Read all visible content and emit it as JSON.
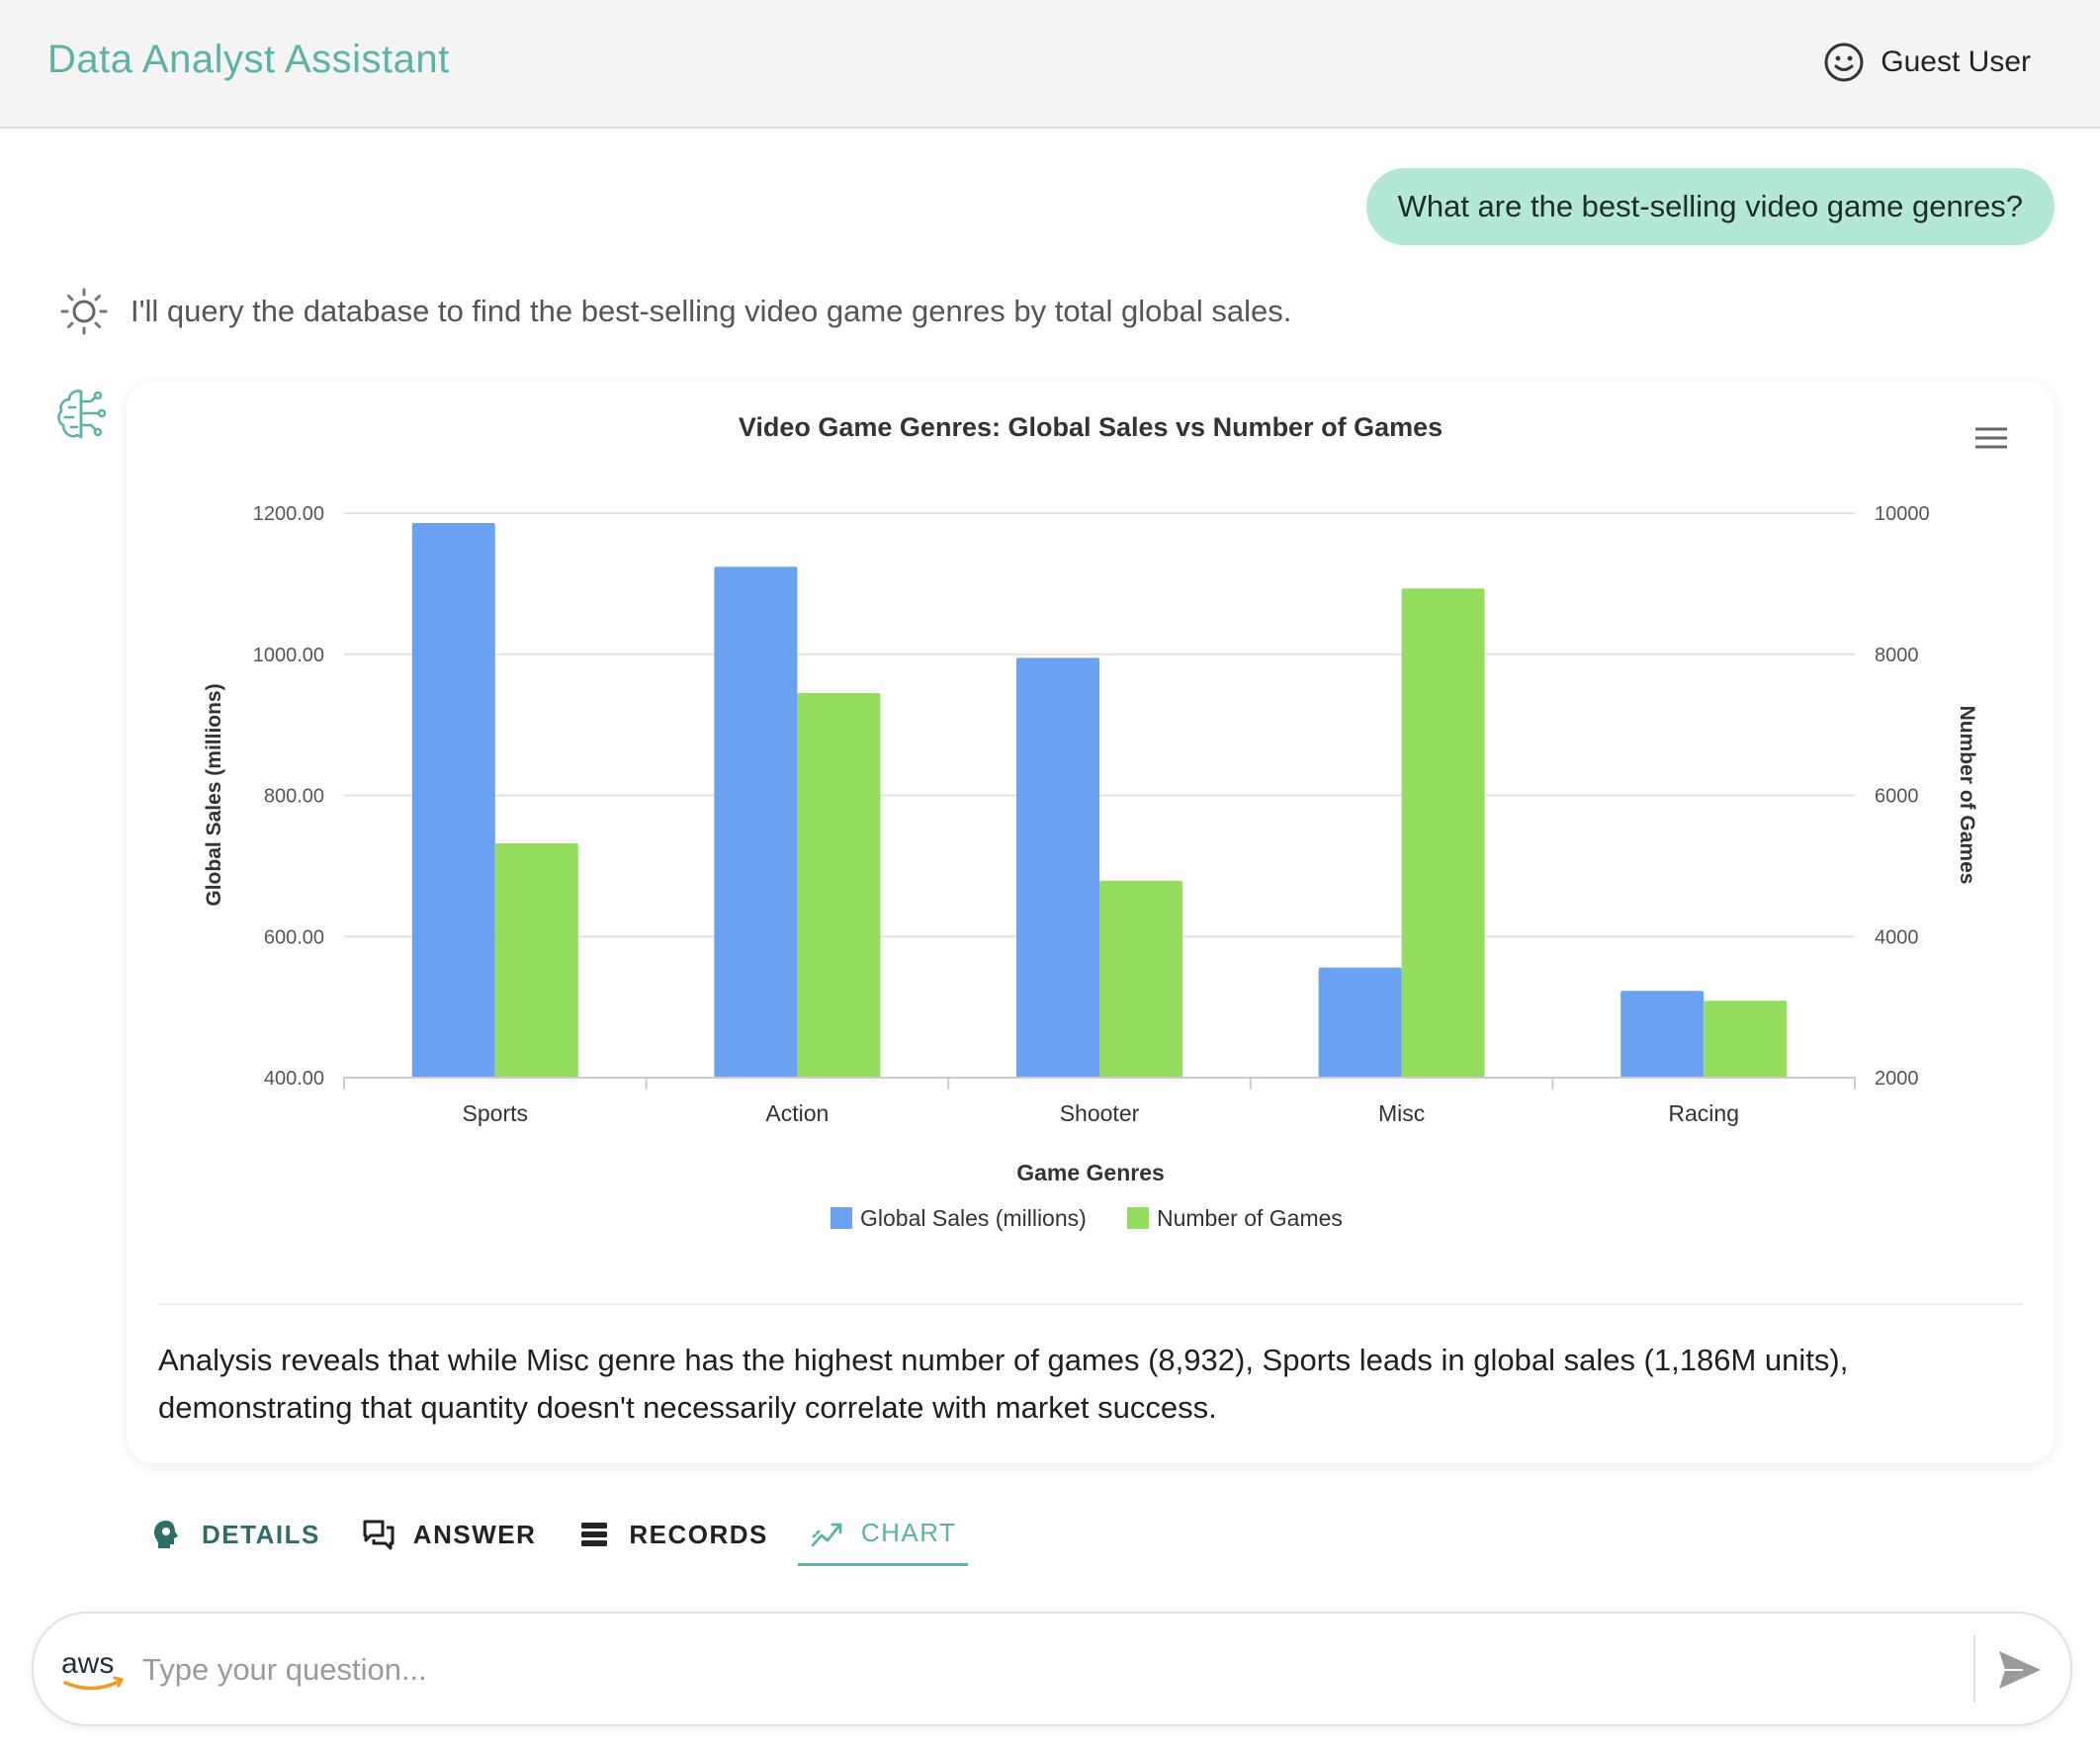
{
  "header": {
    "title": "Data Analyst Assistant",
    "user_name": "Guest User"
  },
  "conversation": {
    "user_message": "What are the best-selling video game genres?",
    "assistant_thought": "I'll query the database to find the best-selling video game genres by total global sales.",
    "summary": "Analysis reveals that while Misc genre has the highest number of games (8,932), Sports leads in global sales (1,186M units), demonstrating that quantity doesn't necessarily correlate with market success."
  },
  "chart_data": {
    "type": "bar",
    "title": "Video Game Genres: Global Sales vs Number of Games",
    "xlabel": "Game Genres",
    "ylabel": "Global Sales (millions)",
    "y2label": "Number of Games",
    "categories": [
      "Sports",
      "Action",
      "Shooter",
      "Misc",
      "Racing"
    ],
    "ylim": [
      400,
      1200
    ],
    "y2lim": [
      2000,
      10000
    ],
    "yticks": [
      "400.00",
      "600.00",
      "800.00",
      "1000.00",
      "1200.00"
    ],
    "y2ticks": [
      "2000",
      "4000",
      "6000",
      "8000",
      "10000"
    ],
    "grid": true,
    "legend_position": "bottom",
    "series": [
      {
        "name": "Global Sales (millions)",
        "axis": "left",
        "color": "#6aa1f0",
        "values": [
          1186,
          1124,
          995,
          556,
          523
        ]
      },
      {
        "name": "Number of Games",
        "axis": "right",
        "color": "#94dd5e",
        "values": [
          5320,
          7450,
          4790,
          8932,
          3090
        ]
      }
    ]
  },
  "tabs": [
    {
      "label": "DETAILS",
      "icon": "bulb-head-icon"
    },
    {
      "label": "ANSWER",
      "icon": "chat-bubbles-icon"
    },
    {
      "label": "RECORDS",
      "icon": "list-icon"
    },
    {
      "label": "CHART",
      "icon": "trend-chart-icon",
      "active": true
    }
  ],
  "input": {
    "placeholder": "Type your question...",
    "value": ""
  },
  "logo": {
    "text": "aws"
  },
  "colors": {
    "accent": "#5bb3a6",
    "user_bubble": "#b3e8d9"
  }
}
